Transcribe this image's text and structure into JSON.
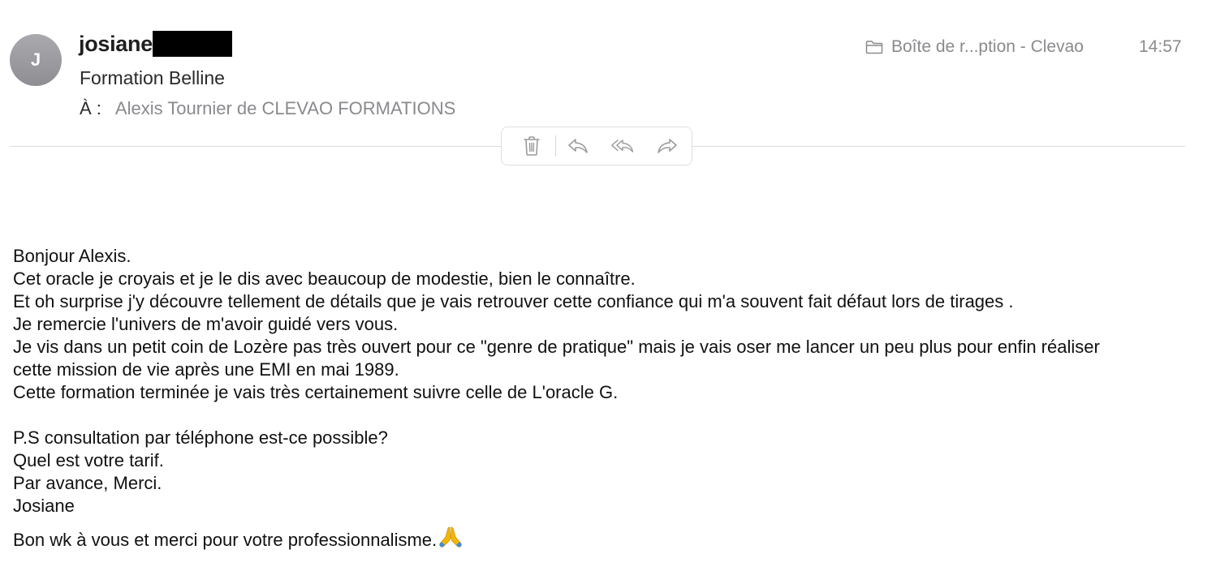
{
  "header": {
    "avatar_initial": "J",
    "sender_name": "josiane",
    "subject": "Formation Belline",
    "to_label": "À :",
    "to_value": "Alexis Tournier de CLEVAO FORMATIONS",
    "mailbox": "Boîte de r...ption - Clevao",
    "mailbox_icon": "folder-icon",
    "time": "14:57"
  },
  "toolbar": {
    "actions": [
      "delete",
      "reply",
      "reply-all",
      "forward"
    ]
  },
  "message": {
    "lines": [
      "Bonjour Alexis.",
      "Cet oracle je croyais et je le dis avec beaucoup de modestie, bien le connaître.",
      "Et oh surprise j'y découvre tellement de détails que je vais retrouver cette confiance qui m'a souvent fait défaut lors de tirages .",
      "Je remercie l'univers de m'avoir guidé vers vous.",
      "Je vis dans un petit coin de Lozère pas très ouvert pour ce \"genre de pratique\" mais je vais oser me lancer un peu plus pour enfin réaliser",
      "cette mission de vie après une EMI en mai 1989.",
      "Cette formation terminée je vais très certainement suivre celle de L'oracle G.",
      "P.S consultation par téléphone est-ce possible?",
      "Quel est votre tarif.",
      "Par avance, Merci.",
      "Josiane",
      "Bon wk à vous et merci pour votre professionnalisme."
    ]
  },
  "colors": {
    "avatar_bg": "#8e8e93",
    "secondary_text": "#8a8a8e",
    "divider": "#dcdcdc",
    "icon_gray": "#9a9a9e"
  }
}
